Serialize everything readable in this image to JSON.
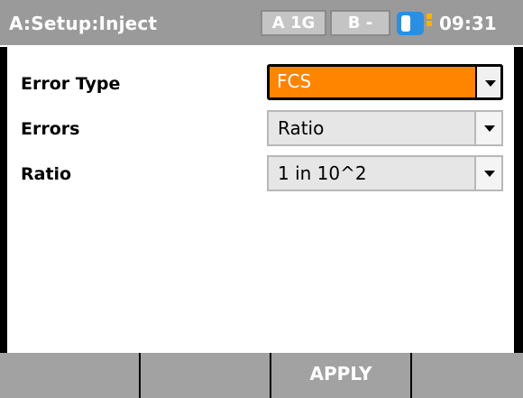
{
  "header": {
    "title": "A:Setup:Inject",
    "port_a": "A 1G",
    "port_b": "B -",
    "battery_icon": "battery-icon",
    "time": "09:31"
  },
  "form": {
    "rows": [
      {
        "label": "Error Type",
        "value": "FCS",
        "focused": true
      },
      {
        "label": "Errors",
        "value": "Ratio",
        "focused": false
      },
      {
        "label": "Ratio",
        "value": "1 in 10^2",
        "focused": false
      }
    ]
  },
  "softkeys": [
    "",
    "",
    "APPLY",
    ""
  ],
  "colors": {
    "focus": "#ff8400",
    "title_bar": "#9a9a9a",
    "softkey": "#a2a2a2",
    "battery": "#2a8fe0"
  }
}
